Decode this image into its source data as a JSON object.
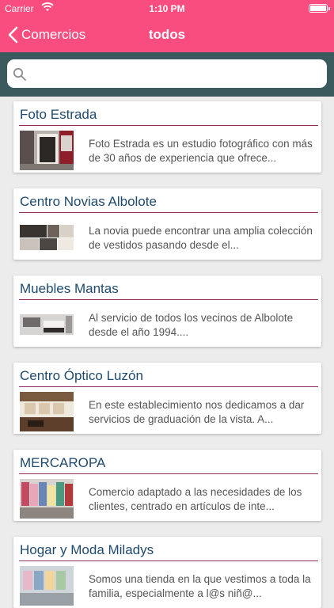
{
  "status_bar": {
    "carrier": "Carrier",
    "time": "1:10 PM"
  },
  "navbar": {
    "back_label": "Comercios",
    "title": "todos"
  },
  "search": {
    "placeholder": ""
  },
  "items": [
    {
      "title": "Foto Estrada",
      "description": "Foto Estrada es un estudio fotográfico con más de 30 años de experiencia que ofrece..."
    },
    {
      "title": "Centro Novias Albolote",
      "description": "La novia puede encontrar una amplia colección de vestidos pasando desde el..."
    },
    {
      "title": "Muebles Mantas",
      "description": "Al servicio de todos los vecinos de Albolote desde el año 1994...."
    },
    {
      "title": "Centro Óptico Luzón",
      "description": "En este establecimiento nos dedicamos a dar servicios de graduación de la vista. A..."
    },
    {
      "title": "MERCAROPA",
      "description": "Comercio adaptado a las necesidades de los clientes, centrado en artículos de inte..."
    },
    {
      "title": "Hogar y Moda Miladys",
      "description": "Somos una tienda en la que vestimos a toda la familia, especialmente a l@s niñ@..."
    }
  ],
  "colors": {
    "header": "#f94d7f",
    "search_bar": "#3a5a5e",
    "divider": "#8f2c62",
    "title": "#1f4a6e"
  }
}
